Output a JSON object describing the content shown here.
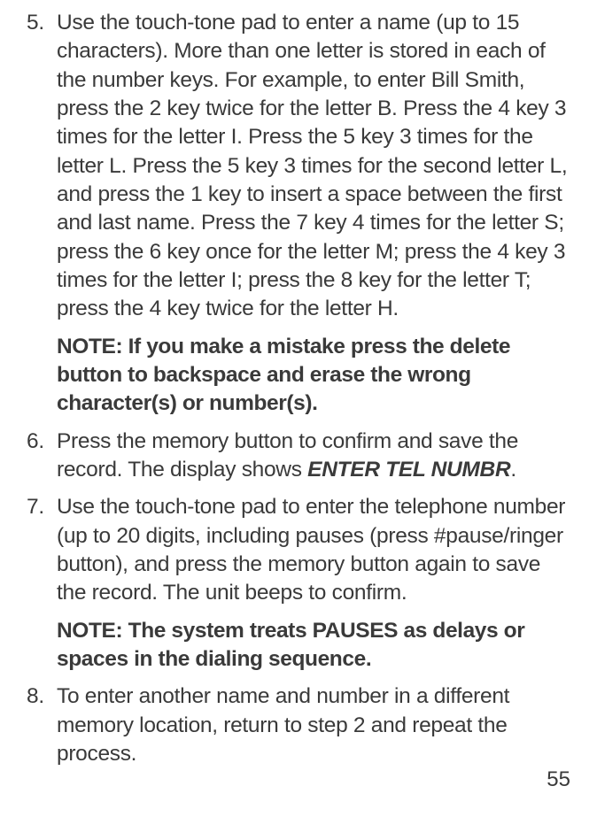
{
  "items": [
    {
      "number": "5.",
      "text": "Use the touch-tone pad to enter a name (up to 15 characters). More than one letter is stored in each of the number keys. For example, to enter Bill Smith, press the 2 key twice for the letter B. Press the 4 key 3 times for the letter I. Press the 5 key 3 times for the letter L. Press the 5 key 3 times for the second letter L, and press the 1 key to insert a space between the first and last name. Press the 7 key 4 times for the letter S; press the 6 key once for the letter M; press the 4 key 3 times for the letter I; press the 8 key for the letter T; press the 4 key twice for the letter H.",
      "note": "NOTE: If you make a mistake press the delete button to backspace and erase the wrong character(s) or number(s)."
    },
    {
      "number": "6.",
      "textPrefix": "Press the memory button to confirm and save the record. The display shows ",
      "textBoldItalic": "ENTER TEL NUMBR",
      "textSuffix": "."
    },
    {
      "number": "7.",
      "text": "Use the touch-tone pad to enter the telephone number (up to 20 digits, including pauses (press #pause/ringer button), and press the memory button again to save the record. The unit beeps to confirm.",
      "note": "NOTE: The system treats PAUSES as delays or spaces in the dialing sequence."
    },
    {
      "number": "8.",
      "text": "To enter another name and number in a different memory location, return to step 2 and repeat the process."
    }
  ],
  "pageNumber": "55"
}
